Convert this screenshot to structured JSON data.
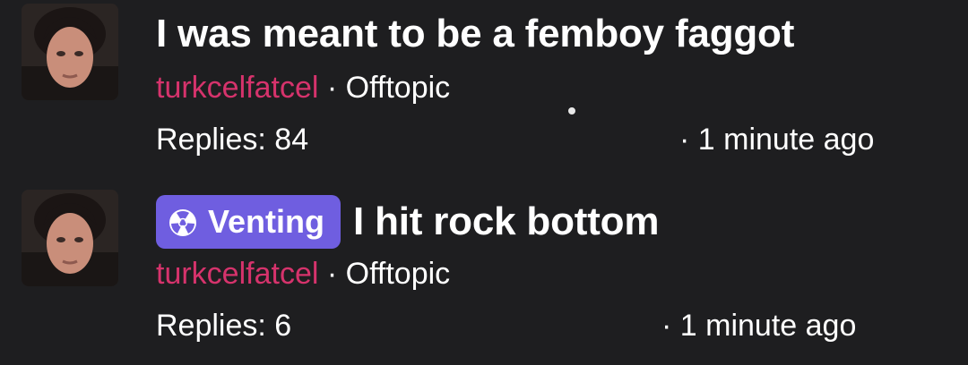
{
  "threads": [
    {
      "title": "I was meant to be a femboy faggot",
      "tag": null,
      "author": "turkcelfatcel",
      "separator": "·",
      "board": "Offtopic",
      "replies": "Replies: 84",
      "time": "· 1 minute ago"
    },
    {
      "title": "I hit rock bottom",
      "tag": {
        "label": "Venting",
        "icon": "radiation-icon"
      },
      "author": "turkcelfatcel",
      "separator": "·",
      "board": "Offtopic",
      "replies": "Replies: 6",
      "time": "· 1 minute ago"
    }
  ],
  "colors": {
    "background": "#1e1e20",
    "author": "#d6336c",
    "tag_background": "#6f5ee0",
    "text": "#ffffff"
  }
}
